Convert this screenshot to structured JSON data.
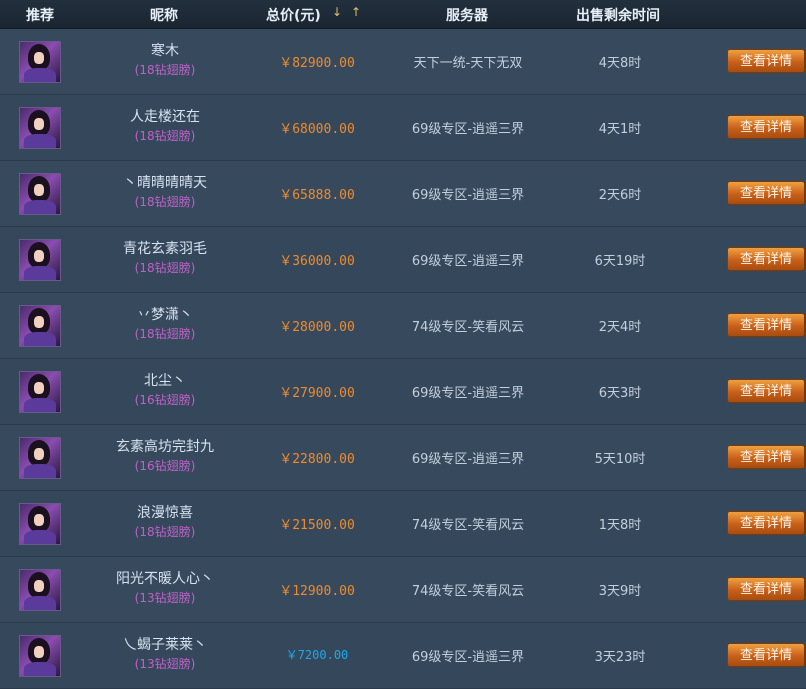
{
  "header": {
    "recommend": "推荐",
    "nickname": "昵称",
    "total_price": "总价(元)",
    "sort_desc_icon": "↓",
    "sort_asc_icon": "↑",
    "server": "服务器",
    "time_left": "出售剩余时间"
  },
  "colors": {
    "price": "#f08a2a",
    "price_low": "#1ea8e8",
    "button": "#d0661e"
  },
  "rows": [
    {
      "name": "寒木",
      "tag": "(18钻翅膀)",
      "price": "￥82900.00",
      "server": "天下一统-天下无双",
      "time": "4天8时",
      "button": "查看详情"
    },
    {
      "name": "人走楼还在",
      "tag": "(18钻翅膀)",
      "price": "￥68000.00",
      "server": "69级专区-逍遥三界",
      "time": "4天1时",
      "button": "查看详情"
    },
    {
      "name": "丶晴晴晴晴天",
      "tag": "(18钻翅膀)",
      "price": "￥65888.00",
      "server": "69级专区-逍遥三界",
      "time": "2天6时",
      "button": "查看详情"
    },
    {
      "name": "青花玄素羽毛",
      "tag": "(18钻翅膀)",
      "price": "￥36000.00",
      "server": "69级专区-逍遥三界",
      "time": "6天19时",
      "button": "查看详情"
    },
    {
      "name": "丷梦潇丶",
      "tag": "(18钻翅膀)",
      "price": "￥28000.00",
      "server": "74级专区-笑看风云",
      "time": "2天4时",
      "button": "查看详情"
    },
    {
      "name": "北尘丶",
      "tag": "(16钻翅膀)",
      "price": "￥27900.00",
      "server": "69级专区-逍遥三界",
      "time": "6天3时",
      "button": "查看详情"
    },
    {
      "name": "玄素高坊完封九",
      "tag": "(16钻翅膀)",
      "price": "￥22800.00",
      "server": "69级专区-逍遥三界",
      "time": "5天10时",
      "button": "查看详情"
    },
    {
      "name": "浪漫惊喜",
      "tag": "(18钻翅膀)",
      "price": "￥21500.00",
      "server": "74级专区-笑看风云",
      "time": "1天8时",
      "button": "查看详情"
    },
    {
      "name": "阳光不暖人心丶",
      "tag": "(13钻翅膀)",
      "price": "￥12900.00",
      "server": "74级专区-笑看风云",
      "time": "3天9时",
      "button": "查看详情"
    },
    {
      "name": "乀蝎子莱莱丶",
      "tag": "(13钻翅膀)",
      "price": "￥7200.00",
      "server": "69级专区-逍遥三界",
      "time": "3天23时",
      "button": "查看详情"
    }
  ]
}
